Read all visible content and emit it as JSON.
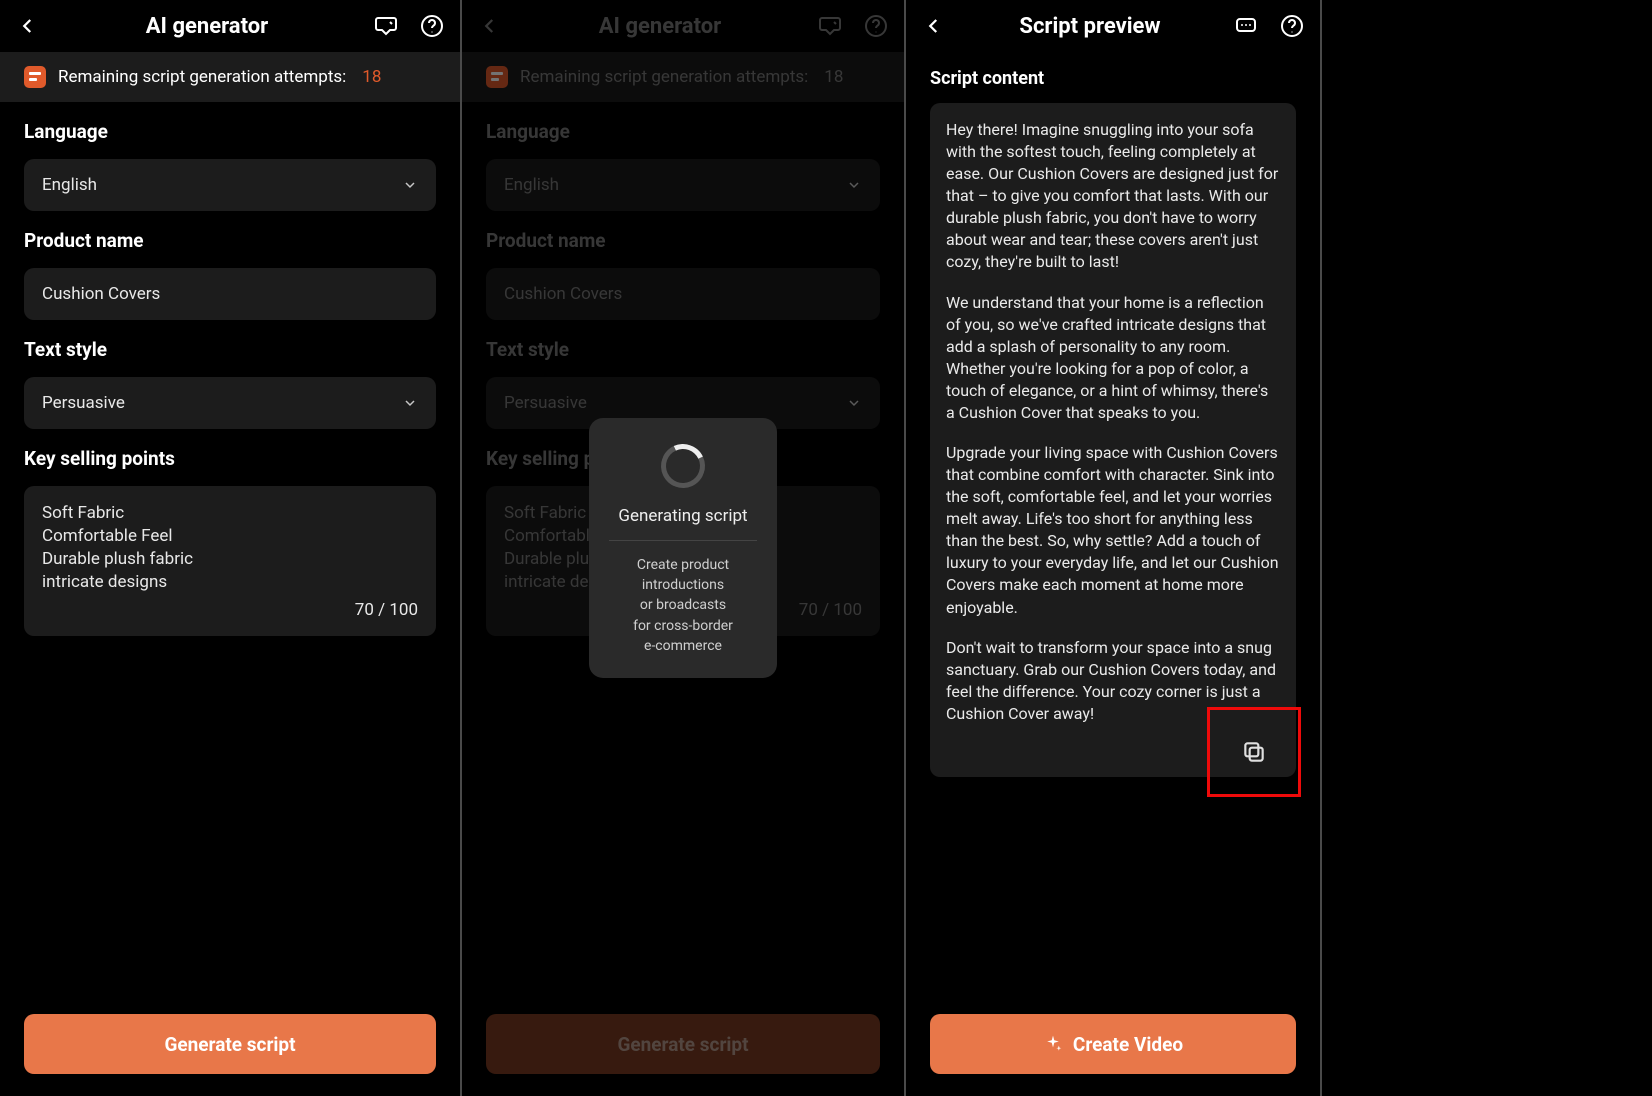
{
  "screen1": {
    "title": "AI generator",
    "banner_text": "Remaining script generation attempts:",
    "banner_count": "18",
    "labels": {
      "language": "Language",
      "product": "Product name",
      "style": "Text style",
      "points": "Key selling points"
    },
    "values": {
      "language": "English",
      "product": "Cushion Covers",
      "style": "Persuasive"
    },
    "points": "Soft Fabric\nComfortable Feel\nDurable plush fabric\nintricate designs",
    "counter": "70 / 100",
    "cta": "Generate script"
  },
  "screen2": {
    "title": "AI generator",
    "banner_text": "Remaining script generation attempts:",
    "banner_count": "18",
    "labels": {
      "language": "Language",
      "product": "Product name",
      "style": "Text style",
      "points": "Key selling points"
    },
    "values": {
      "language": "English",
      "product": "Cushion Covers",
      "style": "Persuasive"
    },
    "points_partial": "Soft Fabric\nComfortable F\nDurable plush\nintricate desig",
    "counter": "70 / 100",
    "cta": "Generate script",
    "modal": {
      "title": "Generating script",
      "sub": "Create product\nintroductions\nor broadcasts\nfor cross-border\ne-commerce"
    }
  },
  "screen3": {
    "title": "Script preview",
    "content_label": "Script content",
    "paragraphs": [
      "Hey there! Imagine snuggling into your sofa with the softest touch, feeling completely at ease. Our Cushion Covers are designed just for that – to give you comfort that lasts. With our durable plush fabric, you don't have to worry about wear and tear; these covers aren't just cozy, they're built to last!",
      "We understand that your home is a reflection of you, so we've crafted intricate designs that add a splash of personality to any room. Whether you're looking for a pop of color, a touch of elegance, or a hint of whimsy, there's a Cushion Cover that speaks to you.",
      "Upgrade your living space with Cushion Covers that combine comfort with character. Sink into the soft, comfortable feel, and let your worries melt away. Life's too short for anything less than the best. So, why settle? Add a touch of luxury to your everyday life, and let our Cushion Covers make each moment at home more enjoyable.",
      "Don't wait to transform your space into a snug sanctuary. Grab our Cushion Covers today, and feel the difference. Your cozy corner is just a Cushion Cover away!"
    ],
    "cta": "Create Video"
  }
}
